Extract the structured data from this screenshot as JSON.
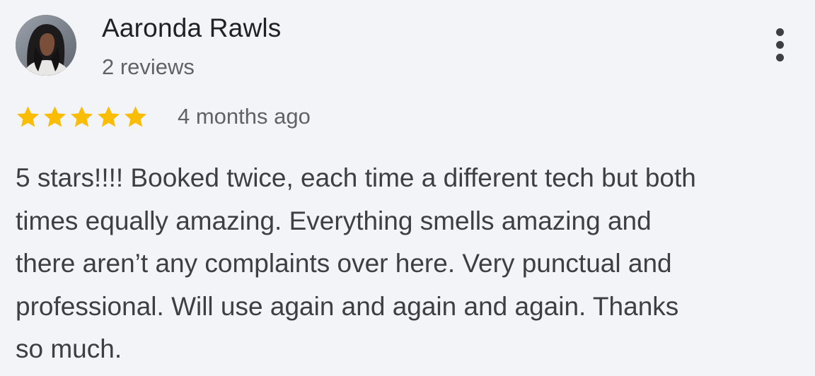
{
  "review": {
    "author": {
      "name": "Aaronda Rawls",
      "review_count": "2 reviews",
      "avatar": "profile-photo"
    },
    "menu_icon": "more-vertical-icon",
    "rating": 5,
    "rating_max": 5,
    "star_color": "#fbbc04",
    "date": "4 months ago",
    "text_lines": [
      "5 stars!!!! Booked twice, each time a different tech but both",
      "times equally amazing. Everything smells amazing and",
      "there aren’t any complaints over here. Very punctual and",
      "professional. Will use again and again and again. Thanks",
      "so much."
    ]
  }
}
